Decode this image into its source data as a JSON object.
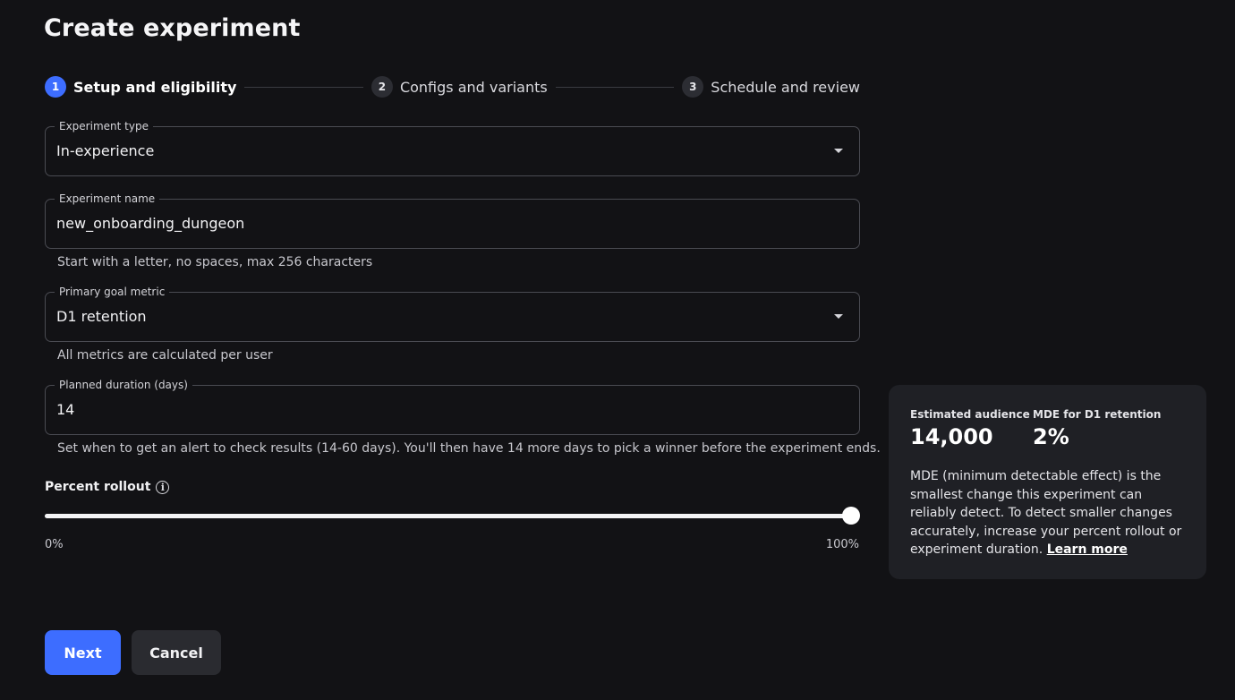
{
  "page": {
    "title": "Create experiment"
  },
  "stepper": {
    "steps": [
      {
        "number": "1",
        "label": "Setup and eligibility",
        "active": true
      },
      {
        "number": "2",
        "label": "Configs and variants",
        "active": false
      },
      {
        "number": "3",
        "label": "Schedule and review",
        "active": false
      }
    ]
  },
  "form": {
    "experiment_type": {
      "label": "Experiment type",
      "value": "In-experience"
    },
    "experiment_name": {
      "label": "Experiment name",
      "value": "new_onboarding_dungeon",
      "helper": "Start with a letter, no spaces, max 256 characters"
    },
    "primary_goal_metric": {
      "label": "Primary goal metric",
      "value": "D1 retention",
      "helper": "All metrics are calculated per user"
    },
    "planned_duration": {
      "label": "Planned duration (days)",
      "value": "14",
      "helper": "Set when to get an alert to check results (14-60 days). You'll then have 14 more days to pick a winner before the experiment ends."
    },
    "percent_rollout": {
      "label": "Percent rollout",
      "info_icon": "i",
      "value_percent": 100,
      "min_label": "0%",
      "max_label": "100%"
    }
  },
  "actions": {
    "next_label": "Next",
    "cancel_label": "Cancel"
  },
  "panel": {
    "estimated_audience_label": "Estimated audience",
    "estimated_audience_value": "14,000",
    "mde_label": "MDE for D1 retention",
    "mde_value": "2%",
    "description": "MDE (minimum detectable effect) is the smallest change this experiment can reliably detect. To detect smaller changes accurately, increase your percent rollout or experiment duration. ",
    "learn_more_label": "Learn more"
  },
  "colors": {
    "background": "#121215",
    "accent": "#3d6dff",
    "panel": "#1f2025",
    "border": "#4a4b52"
  }
}
